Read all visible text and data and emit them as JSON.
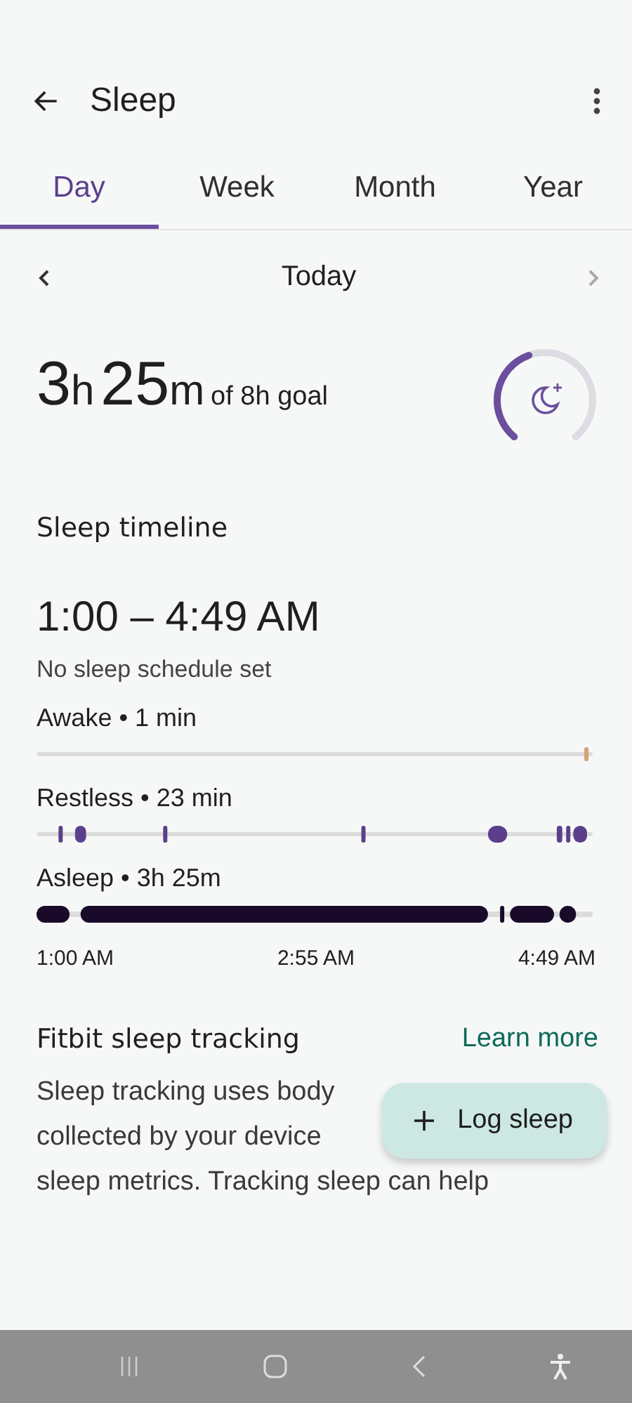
{
  "header": {
    "title": "Sleep"
  },
  "tabs": [
    {
      "label": "Day",
      "selected": true
    },
    {
      "label": "Week",
      "selected": false
    },
    {
      "label": "Month",
      "selected": false
    },
    {
      "label": "Year",
      "selected": false
    }
  ],
  "date_nav": {
    "label": "Today",
    "next_disabled": true
  },
  "summary": {
    "hours": "3",
    "hours_unit": "h",
    "minutes": "25",
    "minutes_unit": "m",
    "goal": "of 8h goal"
  },
  "timeline": {
    "title": "Sleep timeline",
    "range": "1:00 – 4:49 AM",
    "schedule": "No sleep schedule set",
    "stages": [
      {
        "kind": "awake",
        "label": "Awake • 1 min"
      },
      {
        "kind": "restless",
        "label": "Restless • 23 min"
      },
      {
        "kind": "asleep",
        "label": "Asleep • 3h 25m"
      }
    ],
    "axis": [
      "1:00 AM",
      "2:55 AM",
      "4:49 AM"
    ]
  },
  "tracking": {
    "title": "Fitbit sleep tracking",
    "link": "Learn more",
    "lines": [
      "Sleep tracking uses body",
      "collected by your device",
      "sleep metrics. Tracking sleep can help"
    ]
  },
  "fab": {
    "label": "Log sleep"
  }
}
